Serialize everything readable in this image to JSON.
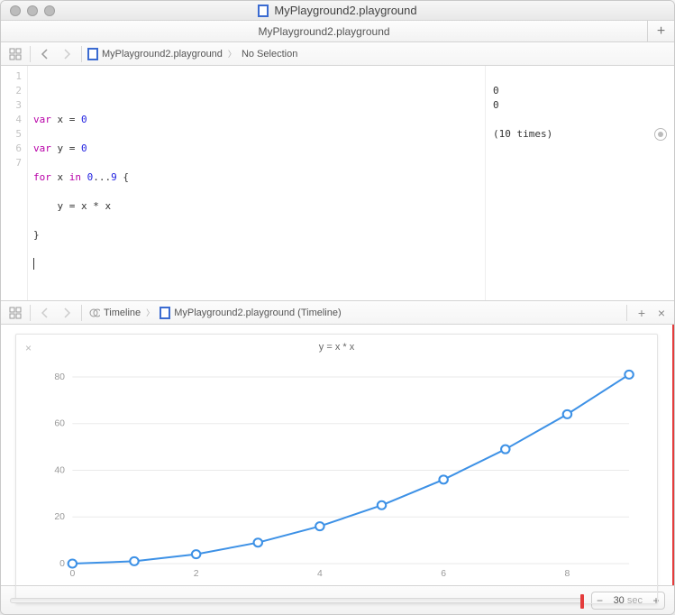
{
  "window": {
    "title": "MyPlayground2.playground",
    "tab_title": "MyPlayground2.playground"
  },
  "breadcrumb": {
    "file": "MyPlayground2.playground",
    "selection": "No Selection"
  },
  "code": {
    "lines": [
      "1",
      "2",
      "3",
      "4",
      "5",
      "6",
      "7"
    ],
    "l2a": "var",
    "l2b": " x = ",
    "l2c": "0",
    "l3a": "var",
    "l3b": " y = ",
    "l3c": "0",
    "l4a": "for",
    "l4b": " x ",
    "l4c": "in",
    "l4d": " ",
    "l4e": "0",
    "l4f": "...",
    "l4g": "9",
    "l4h": " {",
    "l5": "    y = x * x",
    "l6": "}"
  },
  "results": {
    "r1": "0",
    "r2": "0",
    "r3": "(10 times)"
  },
  "timeline_breadcrumb": {
    "a": "Timeline",
    "b": "MyPlayground2.playground (Timeline)"
  },
  "chart_data": {
    "type": "line",
    "title": "y = x * x",
    "x": [
      0,
      1,
      2,
      3,
      4,
      5,
      6,
      7,
      8,
      9
    ],
    "values": [
      0,
      1,
      4,
      9,
      16,
      25,
      36,
      49,
      64,
      81
    ],
    "xlabel": "",
    "ylabel": "",
    "x_ticks": [
      0,
      2,
      4,
      6,
      8
    ],
    "y_ticks": [
      0,
      20,
      40,
      60,
      80
    ],
    "xlim": [
      0,
      9
    ],
    "ylim": [
      0,
      85
    ]
  },
  "bottom": {
    "duration_value": "30",
    "duration_unit": "sec"
  }
}
